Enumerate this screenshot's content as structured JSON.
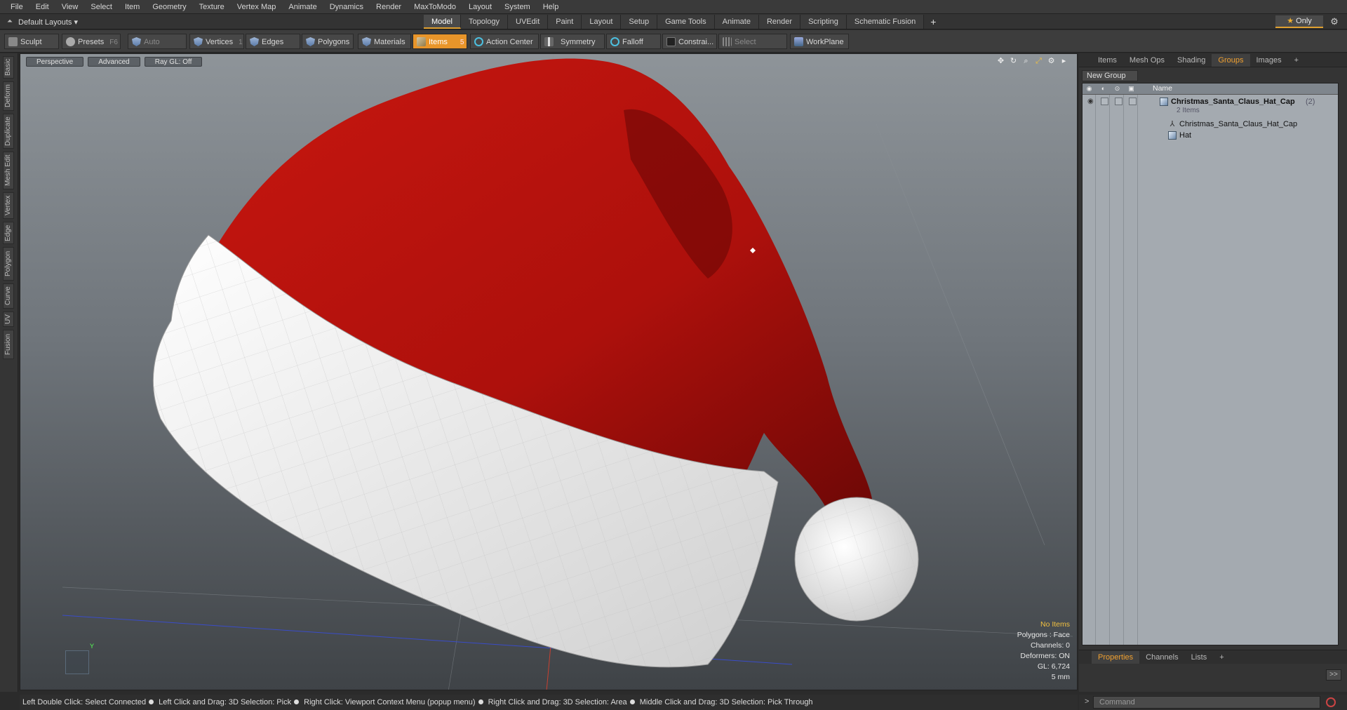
{
  "menu": [
    "File",
    "Edit",
    "View",
    "Select",
    "Item",
    "Geometry",
    "Texture",
    "Vertex Map",
    "Animate",
    "Dynamics",
    "Render",
    "MaxToModo",
    "Layout",
    "System",
    "Help"
  ],
  "layout_picker": "Default Layouts ▾",
  "tabs": [
    "Model",
    "Topology",
    "UVEdit",
    "Paint",
    "Layout",
    "Setup",
    "Game Tools",
    "Animate",
    "Render",
    "Scripting",
    "Schematic Fusion"
  ],
  "active_tab": "Model",
  "only_label": "Only",
  "toolbar": {
    "sculpt": "Sculpt",
    "presets": "Presets",
    "presets_key": "F6",
    "auto_select": "Auto Select",
    "vertices": "Vertices",
    "vertices_key": "1",
    "edges": "Edges",
    "edges_key": "2",
    "polygons": "Polygons",
    "materials": "Materials",
    "items": "Items",
    "items_key": "5",
    "action_center": "Action Center",
    "symmetry": "Symmetry",
    "falloff": "Falloff",
    "constraints": "Constrai...",
    "select_through": "Select Through",
    "workplane": "WorkPlane"
  },
  "left_tabs": [
    "Basic",
    "Deform",
    "Duplicate",
    "Mesh Edit",
    "Vertex",
    "Edge",
    "Polygon",
    "Curve",
    "UV",
    "Fusion"
  ],
  "viewport": {
    "perspective": "Perspective",
    "advanced": "Advanced",
    "raygl": "Ray GL: Off",
    "info": {
      "no_items": "No Items",
      "polygons": "Polygons : Face",
      "channels": "Channels: 0",
      "deformers": "Deformers: ON",
      "gl": "GL: 6,724",
      "scale": "5 mm"
    },
    "axis_label": "Y"
  },
  "colors": {
    "hat_red": "#b8120e",
    "hat_white": "#f2f2f2",
    "accent": "#e8952a"
  },
  "right_panel": {
    "tabs": [
      "Items",
      "Mesh Ops",
      "Shading",
      "Groups",
      "Images"
    ],
    "active_tab": "Groups",
    "new_group": "New Group",
    "name_header": "Name",
    "group_name": "Christmas_Santa_Claus_Hat_Cap",
    "group_count": "(2)",
    "group_sub": "2 Items",
    "children": [
      "Christmas_Santa_Claus_Hat_Cap",
      "Hat"
    ],
    "bottom_tabs": [
      "Properties",
      "Channels",
      "Lists"
    ],
    "bottom_active": "Properties"
  },
  "status": {
    "hints": [
      "Left Double Click: Select Connected",
      "Left Click and Drag: 3D Selection: Pick",
      "Right Click: Viewport Context Menu (popup menu)",
      "Right Click and Drag: 3D Selection: Area",
      "Middle Click and Drag: 3D Selection: Pick Through"
    ]
  },
  "command_placeholder": "Command",
  "panel_expand": ">>"
}
